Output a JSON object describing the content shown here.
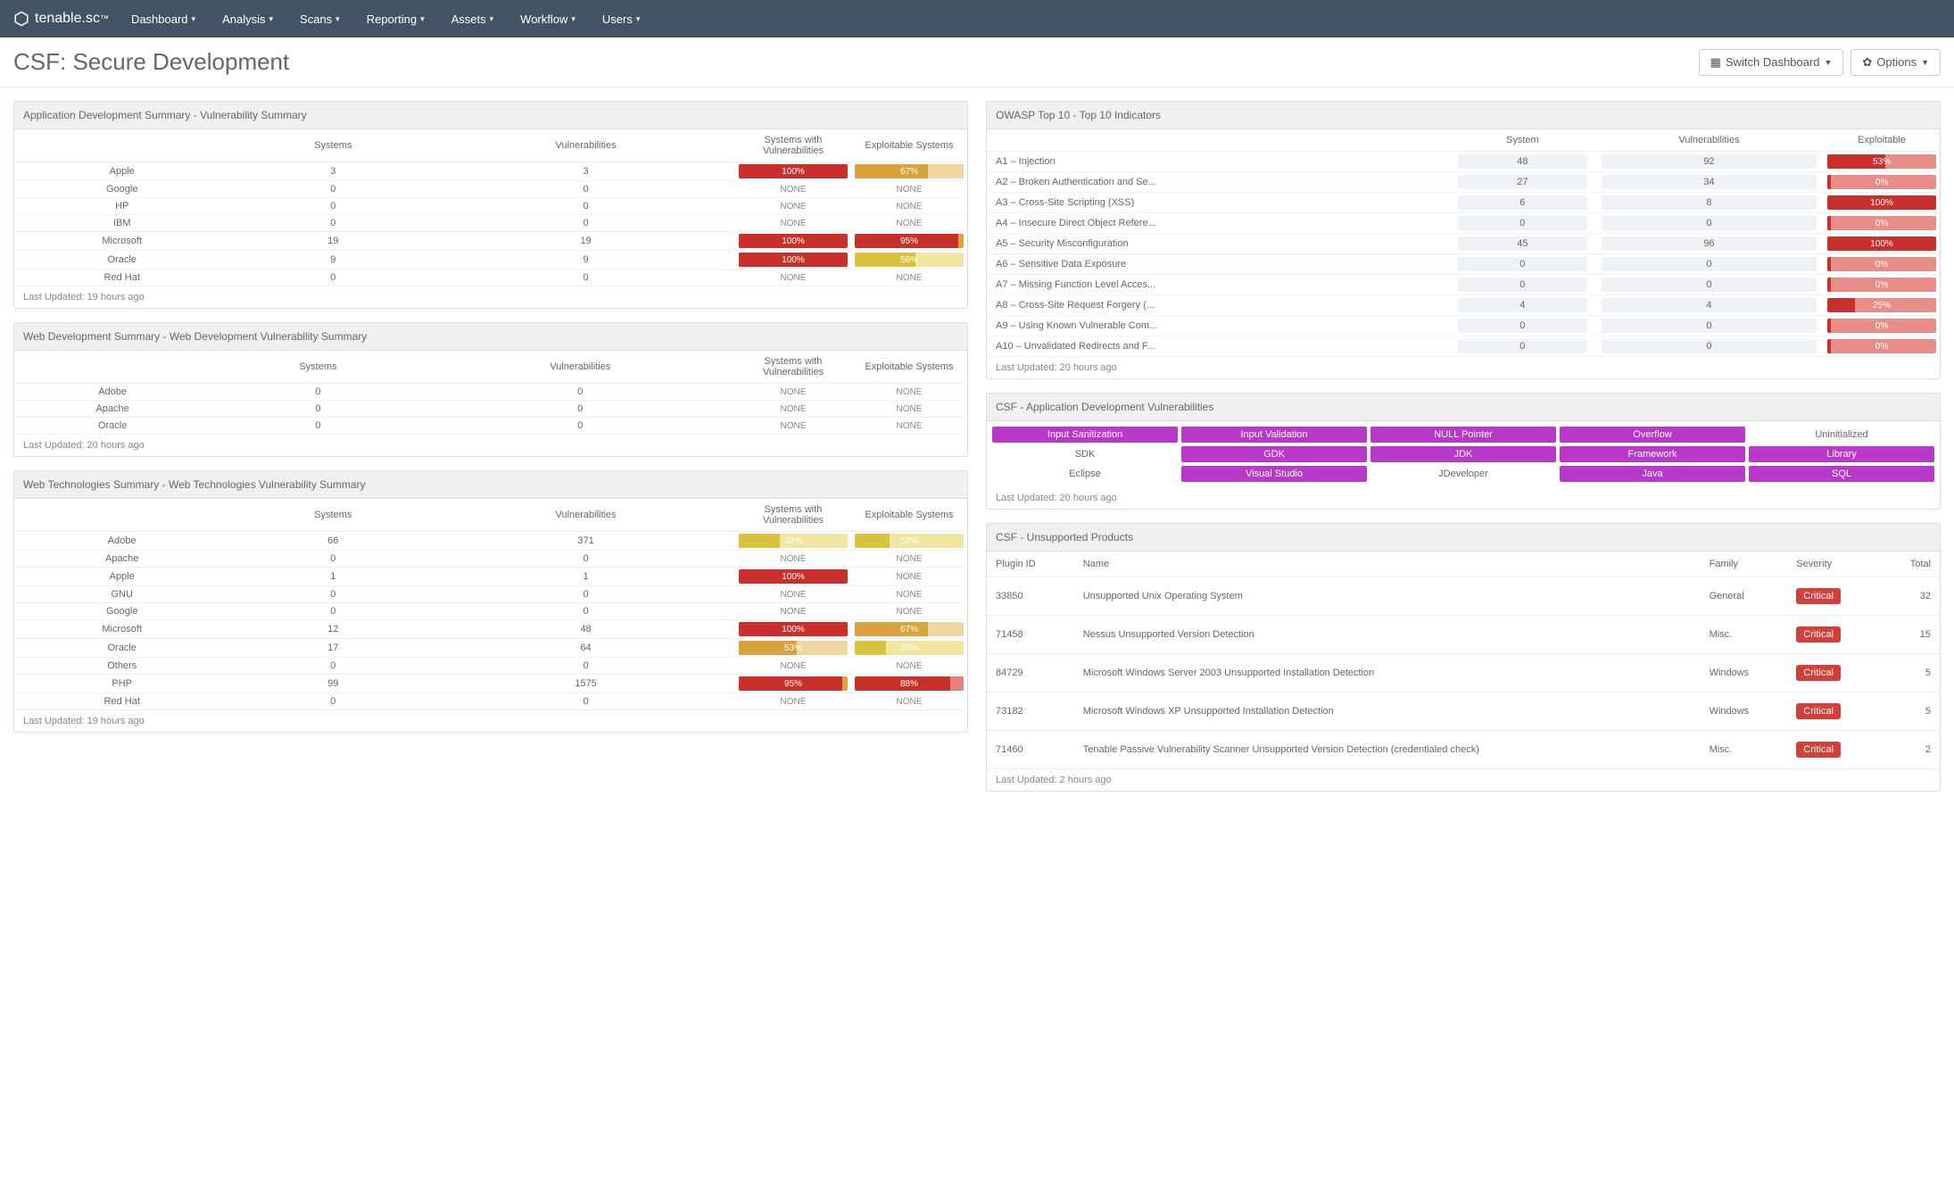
{
  "nav": {
    "brand": "tenable.sc",
    "items": [
      "Dashboard",
      "Analysis",
      "Scans",
      "Reporting",
      "Assets",
      "Workflow",
      "Users"
    ]
  },
  "page": {
    "title": "CSF: Secure Development",
    "switch_btn": "Switch Dashboard",
    "options_btn": "Options"
  },
  "panel_app_dev": {
    "title": "Application Development Summary - Vulnerability Summary",
    "headers": [
      "",
      "Systems",
      "Vulnerabilities",
      "Systems with Vulnerabilities",
      "Exploitable Systems"
    ],
    "rows": [
      {
        "label": "Apple",
        "sys": "3",
        "vuln": "3",
        "swv": {
          "pct": 100,
          "color": "#c9302c",
          "bg": "#e6a23c"
        },
        "exp": {
          "pct": 67,
          "color": "#d9a23c",
          "bg": "#f0d6a0"
        }
      },
      {
        "label": "Google",
        "sys": "0",
        "vuln": "0",
        "swv": null,
        "exp": null
      },
      {
        "label": "HP",
        "sys": "0",
        "vuln": "0",
        "swv": null,
        "exp": null
      },
      {
        "label": "IBM",
        "sys": "0",
        "vuln": "0",
        "swv": null,
        "exp": null
      },
      {
        "label": "Microsoft",
        "sys": "19",
        "vuln": "19",
        "swv": {
          "pct": 100,
          "color": "#c9302c",
          "bg": "#e6a23c"
        },
        "exp": {
          "pct": 95,
          "color": "#c9302c",
          "bg": "#e6a23c"
        }
      },
      {
        "label": "Oracle",
        "sys": "9",
        "vuln": "9",
        "swv": {
          "pct": 100,
          "color": "#c9302c",
          "bg": "#e6a23c"
        },
        "exp": {
          "pct": 56,
          "color": "#d9c23c",
          "bg": "#f0e6a0"
        }
      },
      {
        "label": "Red Hat",
        "sys": "0",
        "vuln": "0",
        "swv": null,
        "exp": null
      }
    ],
    "footer": "Last Updated: 19 hours ago"
  },
  "panel_web_dev": {
    "title": "Web Development Summary - Web Development Vulnerability Summary",
    "headers": [
      "",
      "Systems",
      "Vulnerabilities",
      "Systems with Vulnerabilities",
      "Exploitable Systems"
    ],
    "rows": [
      {
        "label": "Adobe",
        "sys": "0",
        "vuln": "0",
        "swv": null,
        "exp": null
      },
      {
        "label": "Apache",
        "sys": "0",
        "vuln": "0",
        "swv": null,
        "exp": null
      },
      {
        "label": "Oracle",
        "sys": "0",
        "vuln": "0",
        "swv": null,
        "exp": null
      }
    ],
    "footer": "Last Updated: 20 hours ago"
  },
  "panel_web_tech": {
    "title": "Web Technologies Summary - Web Technologies Vulnerability Summary",
    "headers": [
      "",
      "Systems",
      "Vulnerabilities",
      "Systems with Vulnerabilities",
      "Exploitable Systems"
    ],
    "rows": [
      {
        "label": "Adobe",
        "sys": "66",
        "vuln": "371",
        "swv": {
          "pct": 38,
          "color": "#d9c23c",
          "bg": "#f0e6a0"
        },
        "exp": {
          "pct": 32,
          "color": "#d9c23c",
          "bg": "#f0e6a0"
        }
      },
      {
        "label": "Apache",
        "sys": "0",
        "vuln": "0",
        "swv": null,
        "exp": null
      },
      {
        "label": "Apple",
        "sys": "1",
        "vuln": "1",
        "swv": {
          "pct": 100,
          "color": "#c9302c",
          "bg": "#e6a23c"
        },
        "exp": null
      },
      {
        "label": "GNU",
        "sys": "0",
        "vuln": "0",
        "swv": null,
        "exp": null
      },
      {
        "label": "Google",
        "sys": "0",
        "vuln": "0",
        "swv": null,
        "exp": null
      },
      {
        "label": "Microsoft",
        "sys": "12",
        "vuln": "48",
        "swv": {
          "pct": 100,
          "color": "#c9302c",
          "bg": "#e6a23c"
        },
        "exp": {
          "pct": 67,
          "color": "#d9a23c",
          "bg": "#f0d6a0"
        }
      },
      {
        "label": "Oracle",
        "sys": "17",
        "vuln": "64",
        "swv": {
          "pct": 53,
          "color": "#d9a23c",
          "bg": "#f0d6a0"
        },
        "exp": {
          "pct": 29,
          "color": "#d9c23c",
          "bg": "#f0e6a0"
        }
      },
      {
        "label": "Others",
        "sys": "0",
        "vuln": "0",
        "swv": null,
        "exp": null
      },
      {
        "label": "PHP",
        "sys": "99",
        "vuln": "1575",
        "swv": {
          "pct": 95,
          "color": "#c9302c",
          "bg": "#e6a23c"
        },
        "exp": {
          "pct": 88,
          "color": "#c9302c",
          "bg": "#e6827c"
        }
      },
      {
        "label": "Red Hat",
        "sys": "0",
        "vuln": "0",
        "swv": null,
        "exp": null
      }
    ],
    "footer": "Last Updated: 19 hours ago"
  },
  "panel_owasp": {
    "title": "OWASP Top 10 - Top 10 Indicators",
    "headers": [
      "",
      "System",
      "Vulnerabilities",
      "Exploitable"
    ],
    "rows": [
      {
        "label": "A1 – Injection",
        "sys": "48",
        "vuln": "92",
        "exp": {
          "pct": 53,
          "color": "#c9302c",
          "bg": "#e98d89"
        }
      },
      {
        "label": "A2 – Broken Authentication and Se...",
        "sys": "27",
        "vuln": "34",
        "exp": {
          "pct": 0,
          "color": "#c9302c",
          "bg": "#e98d89"
        }
      },
      {
        "label": "A3 – Cross-Site Scripting (XSS)",
        "sys": "6",
        "vuln": "8",
        "exp": {
          "pct": 100,
          "color": "#c9302c",
          "bg": "#e98d89"
        }
      },
      {
        "label": "A4 – Insecure Direct Object Refere...",
        "sys": "0",
        "vuln": "0",
        "exp": {
          "pct": 0,
          "color": "#c9302c",
          "bg": "#e98d89"
        }
      },
      {
        "label": "A5 – Security Misconfiguration",
        "sys": "45",
        "vuln": "96",
        "exp": {
          "pct": 100,
          "color": "#c9302c",
          "bg": "#e98d89"
        }
      },
      {
        "label": "A6 – Sensitive Data Exposure",
        "sys": "0",
        "vuln": "0",
        "exp": {
          "pct": 0,
          "color": "#c9302c",
          "bg": "#e98d89"
        }
      },
      {
        "label": "A7 – Missing Function Level Acces...",
        "sys": "0",
        "vuln": "0",
        "exp": {
          "pct": 0,
          "color": "#c9302c",
          "bg": "#e98d89"
        }
      },
      {
        "label": "A8 – Cross-Site Request Forgery (...",
        "sys": "4",
        "vuln": "4",
        "exp": {
          "pct": 25,
          "color": "#c9302c",
          "bg": "#e98d89"
        }
      },
      {
        "label": "A9 – Using Known Vulnerable Com...",
        "sys": "0",
        "vuln": "0",
        "exp": {
          "pct": 0,
          "color": "#c9302c",
          "bg": "#e98d89"
        }
      },
      {
        "label": "A10 – Unvalidated Redirects and F...",
        "sys": "0",
        "vuln": "0",
        "exp": {
          "pct": 0,
          "color": "#c9302c",
          "bg": "#e98d89"
        }
      }
    ],
    "footer": "Last Updated: 20 hours ago"
  },
  "panel_csf_app": {
    "title": "CSF - Application Development Vulnerabilities",
    "items": [
      {
        "label": "Input Sanitization",
        "on": true
      },
      {
        "label": "Input Validation",
        "on": true
      },
      {
        "label": "NULL Pointer",
        "on": true
      },
      {
        "label": "Overflow",
        "on": true
      },
      {
        "label": "Uninitialized",
        "on": false
      },
      {
        "label": "SDK",
        "on": false
      },
      {
        "label": "GDK",
        "on": true
      },
      {
        "label": "JDK",
        "on": true
      },
      {
        "label": "Framework",
        "on": true
      },
      {
        "label": "Library",
        "on": true
      },
      {
        "label": "Eclipse",
        "on": false
      },
      {
        "label": "Visual Studio",
        "on": true
      },
      {
        "label": "JDeveloper",
        "on": false
      },
      {
        "label": "Java",
        "on": true
      },
      {
        "label": "SQL",
        "on": true
      }
    ],
    "footer": "Last Updated: 20 hours ago"
  },
  "panel_unsupported": {
    "title": "CSF - Unsupported Products",
    "headers": [
      "Plugin ID",
      "Name",
      "Family",
      "Severity",
      "Total"
    ],
    "rows": [
      {
        "id": "33850",
        "name": "Unsupported Unix Operating System",
        "family": "General",
        "sev": "Critical",
        "total": "32"
      },
      {
        "id": "71458",
        "name": "Nessus Unsupported Version Detection",
        "family": "Misc.",
        "sev": "Critical",
        "total": "15"
      },
      {
        "id": "84729",
        "name": "Microsoft Windows Server 2003 Unsupported Installation Detection",
        "family": "Windows",
        "sev": "Critical",
        "total": "5"
      },
      {
        "id": "73182",
        "name": "Microsoft Windows XP Unsupported Installation Detection",
        "family": "Windows",
        "sev": "Critical",
        "total": "5"
      },
      {
        "id": "71460",
        "name": "Tenable Passive Vulnerability Scanner Unsupported Version Detection (credentialed check)",
        "family": "Misc.",
        "sev": "Critical",
        "total": "2"
      }
    ],
    "footer": "Last Updated: 2 hours ago"
  },
  "none_label": "NONE"
}
